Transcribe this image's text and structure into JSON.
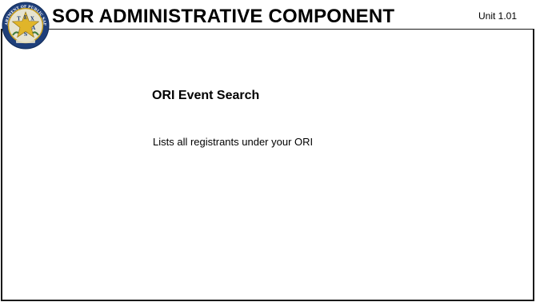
{
  "header": {
    "title": "SOR ADMINISTRATIVE COMPONENT",
    "unit": "Unit 1.01",
    "logo_icon": "texas-dps-seal-icon",
    "seal_text": {
      "arc": "DEPARTMENT OF PUBLIC SAFETY",
      "letters": [
        "T",
        "E",
        "X",
        "A",
        "S"
      ]
    }
  },
  "content": {
    "heading": "ORI Event Search",
    "description": "Lists all registrants under your ORI"
  },
  "colors": {
    "seal_navy": "#1f3f7a",
    "seal_gold": "#e0b52a",
    "seal_green": "#3f7a3a",
    "frame_border": "#1a1a1a"
  }
}
